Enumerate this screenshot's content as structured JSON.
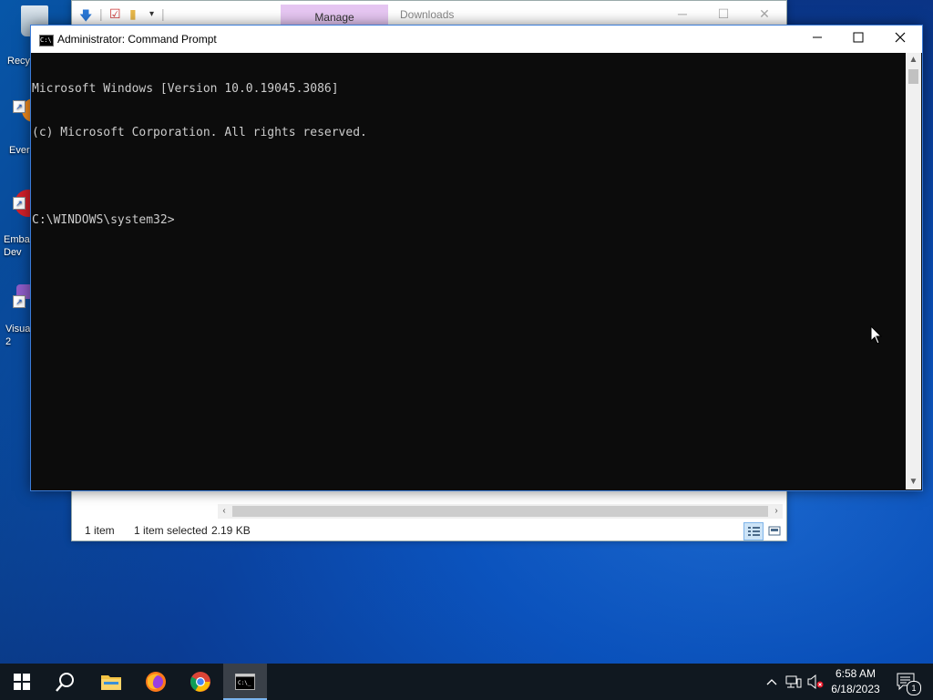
{
  "desktop": {
    "icons": [
      {
        "label": "Recy"
      },
      {
        "label": "Ever"
      },
      {
        "label": "Emba Dev"
      },
      {
        "label": "Visua 2"
      }
    ]
  },
  "explorer": {
    "ribbon_tab": "Manage",
    "title": "Downloads",
    "status_count": "1 item",
    "status_selected": "1 item selected",
    "status_size": "2.19 KB"
  },
  "cmd": {
    "title": "Administrator: Command Prompt",
    "lines": [
      "Microsoft Windows [Version 10.0.19045.3086]",
      "(c) Microsoft Corporation. All rights reserved.",
      "",
      "C:\\WINDOWS\\system32>"
    ]
  },
  "taskbar": {
    "time": "6:58 AM",
    "date": "6/18/2023",
    "notification_count": "1",
    "apps": [
      "start-icon",
      "search-icon",
      "file-explorer-icon",
      "firefox-icon",
      "chrome-icon",
      "command-prompt-icon"
    ]
  }
}
